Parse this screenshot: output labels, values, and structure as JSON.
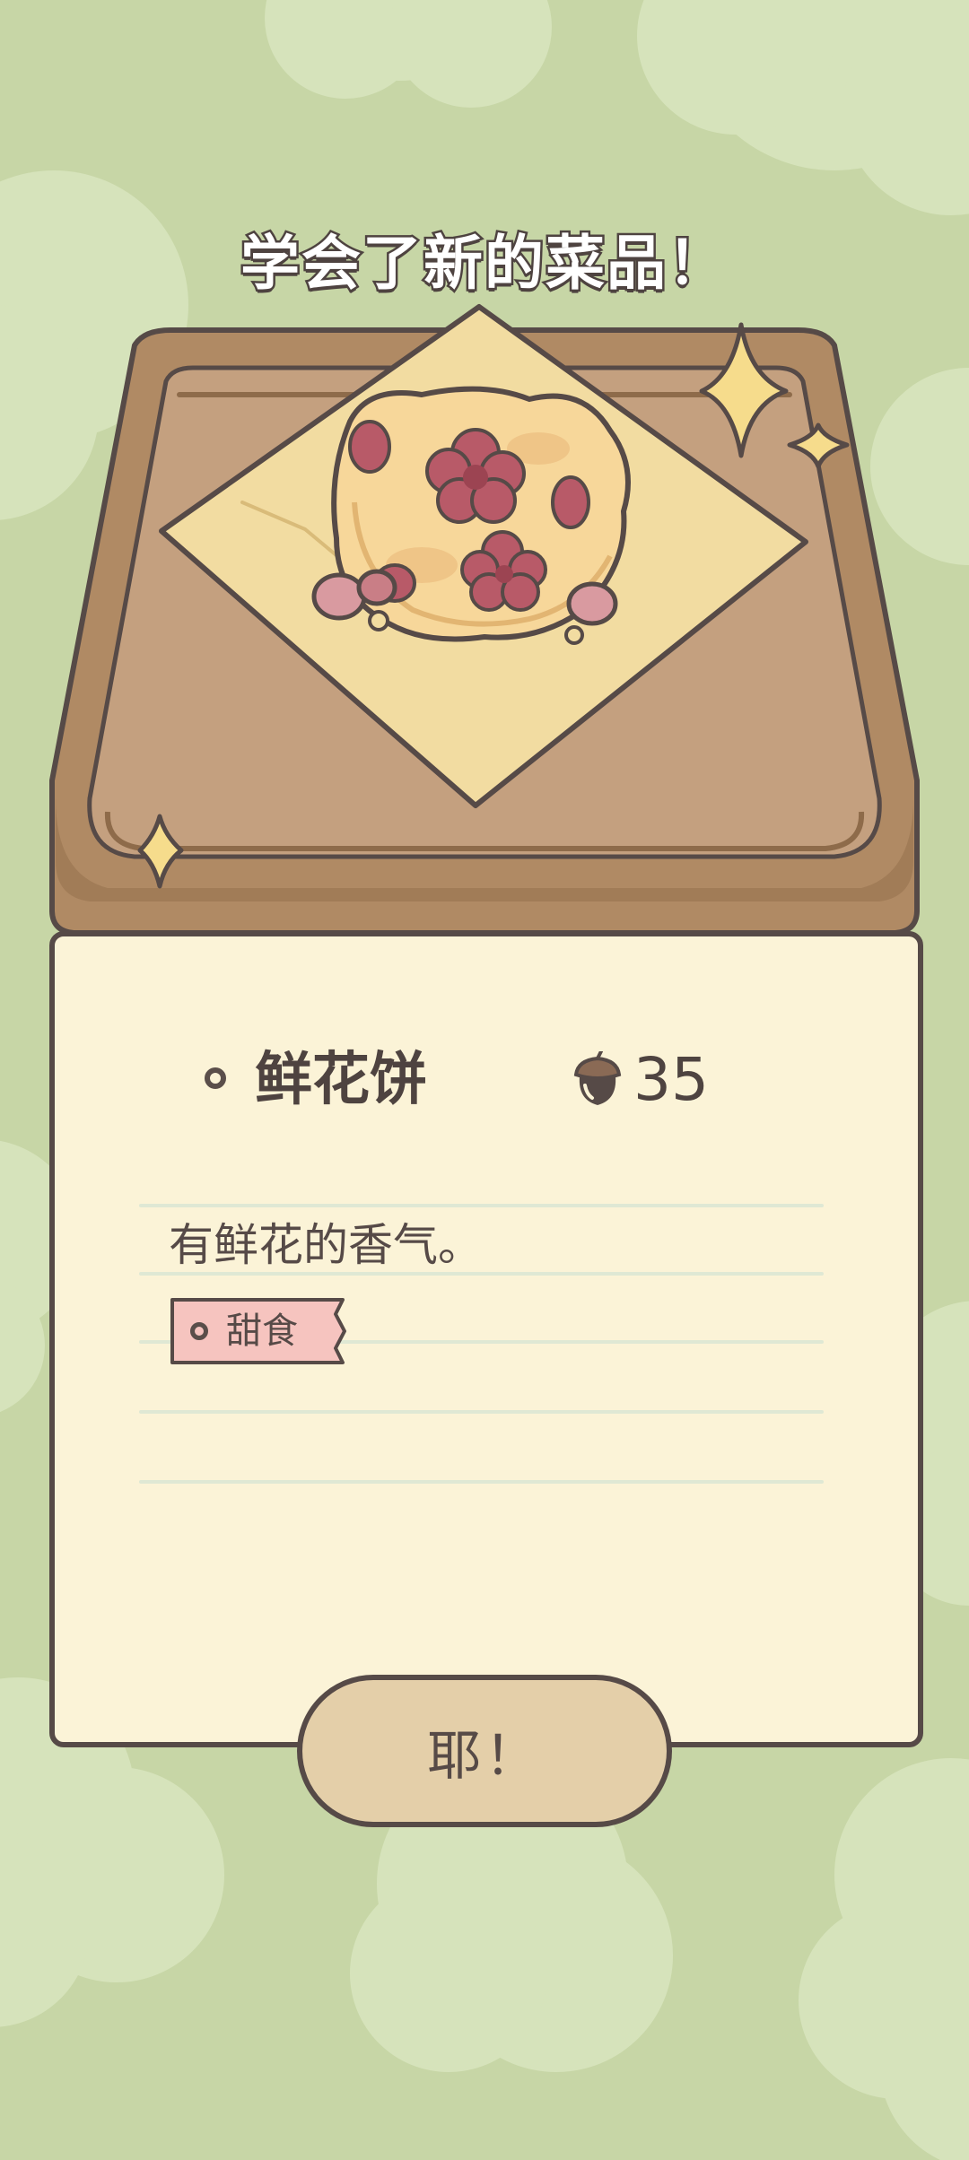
{
  "popup": {
    "title": "学会了新的菜品！"
  },
  "dish": {
    "name": "鲜花饼",
    "price_icon": "acorn-icon",
    "price": "35",
    "description": "有鲜花的香气。",
    "tag": "甜食"
  },
  "confirm_button": {
    "label": "耶！"
  },
  "colors": {
    "background": "#c7d6a6",
    "background_blobs": "#d6e3bb",
    "tray_wood": "#b08a64",
    "tray_inner": "#c4a07f",
    "paper_sheet": "#f2dca1",
    "card": "#fbf3d7",
    "outline": "#564a47",
    "button": "#e4cfa9",
    "tag": "#f6c4bf",
    "flower": "#b85a68"
  }
}
